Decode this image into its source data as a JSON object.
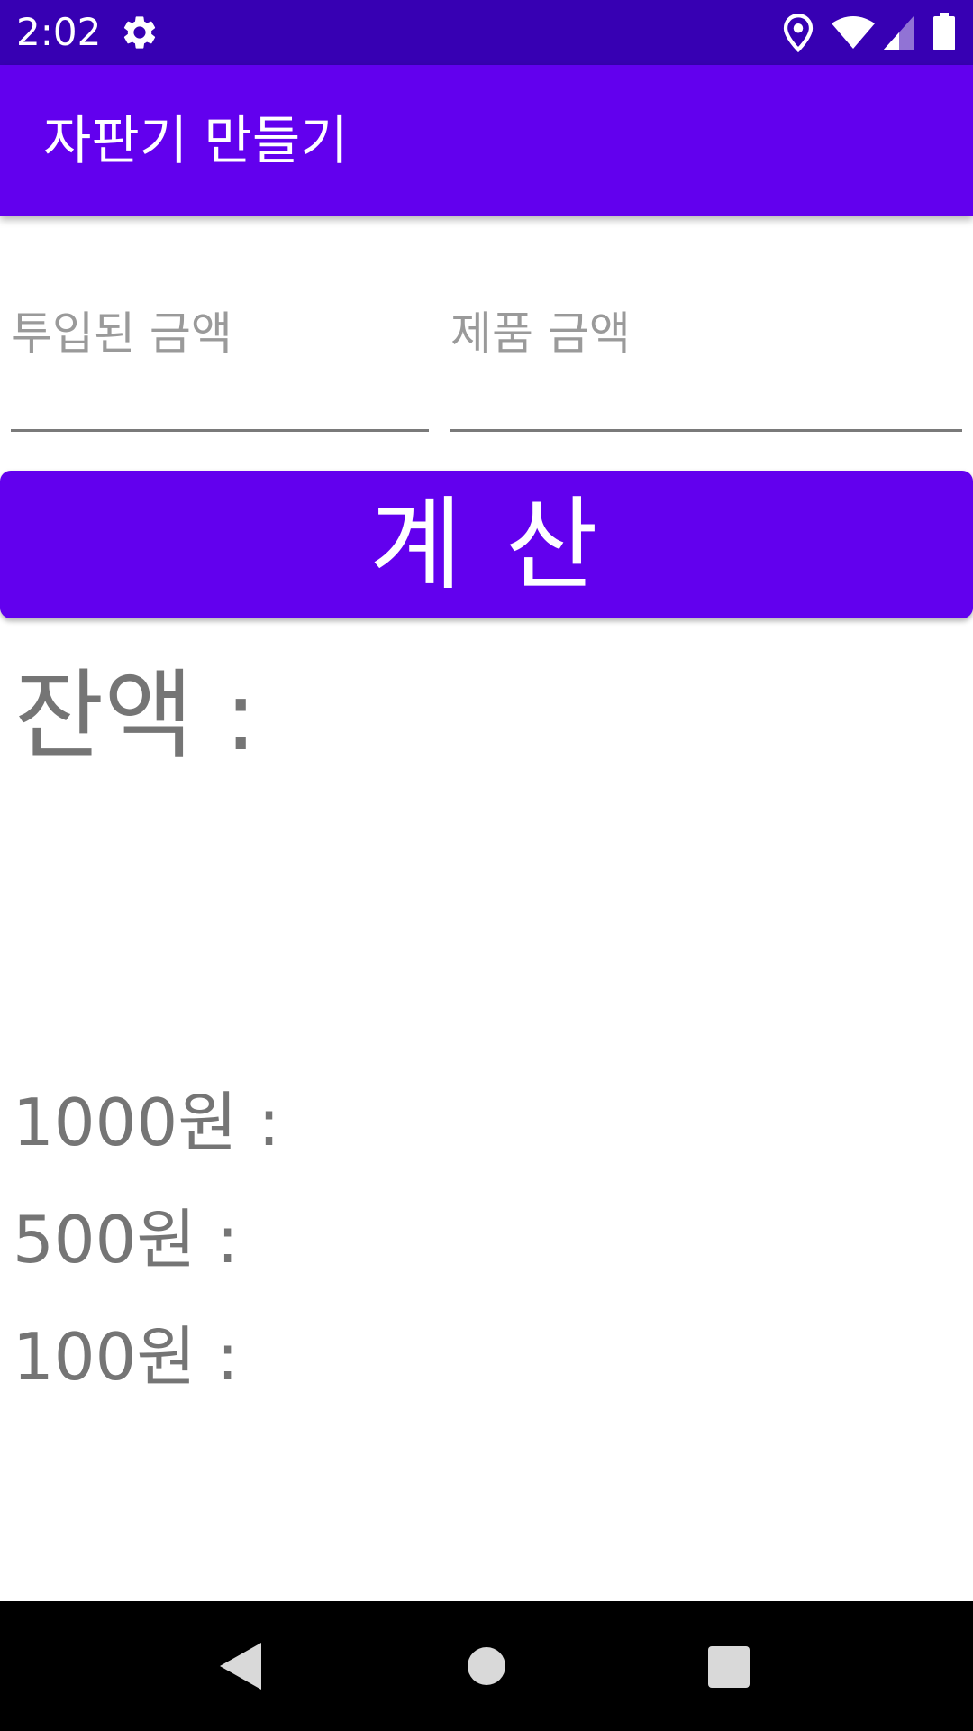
{
  "status_bar": {
    "time": "2:02",
    "icons": [
      "gear-icon",
      "location-icon",
      "wifi-icon",
      "signal-icon",
      "battery-icon"
    ]
  },
  "app_bar": {
    "title": "자판기 만들기",
    "color": "#6200ee"
  },
  "form": {
    "inserted_amount": {
      "value": "",
      "placeholder": "투입된 금액"
    },
    "product_price": {
      "value": "",
      "placeholder": "제품 금액"
    },
    "calculate_label": "계 산"
  },
  "result": {
    "balance_label": "잔액 :",
    "coins": [
      {
        "label": "1000원 :"
      },
      {
        "label": "500원 :"
      },
      {
        "label": "100원 :"
      }
    ]
  },
  "navigation": {
    "icons": [
      "back-icon",
      "home-icon",
      "recents-icon"
    ]
  },
  "colors": {
    "status_bar": "#3700b3",
    "primary": "#6200ee",
    "text_secondary": "#757575"
  }
}
